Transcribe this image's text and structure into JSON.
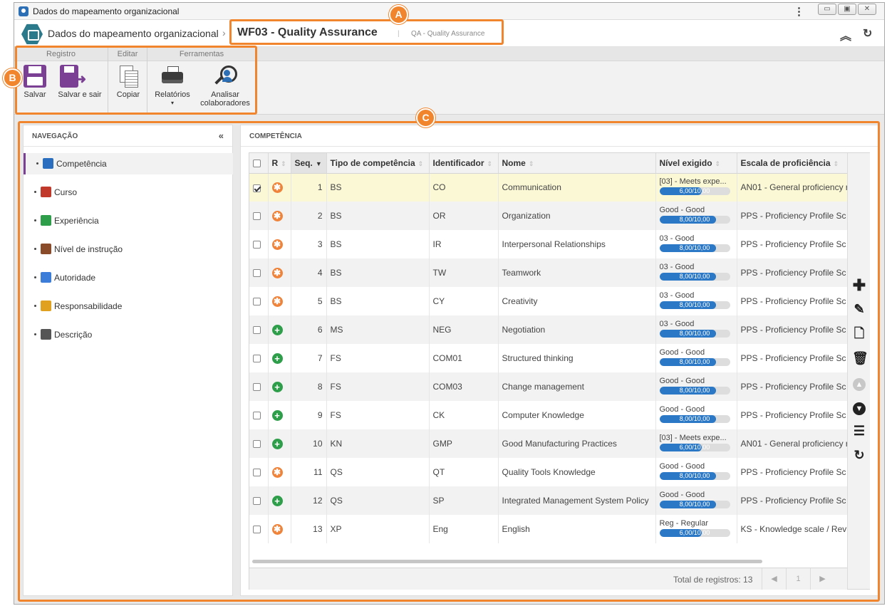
{
  "window": {
    "title": "Dados do mapeamento organizacional"
  },
  "header": {
    "breadcrumb": "Dados do mapeamento organizacional",
    "separator": "›",
    "doc_title": "WF03 - Quality Assurance",
    "pipe": "|",
    "subtitle": "QA - Quality Assurance"
  },
  "toolbar": {
    "groups": [
      "Registro",
      "Editar",
      "Ferramentas"
    ],
    "save": "Salvar",
    "save_exit": "Salvar e sair",
    "copy": "Copiar",
    "reports": "Relatórios",
    "reports_caret": "▾",
    "analyze_line1": "Analisar",
    "analyze_line2": "colaboradores"
  },
  "nav": {
    "title": "NAVEGAÇÃO",
    "items": [
      {
        "label": "Competência",
        "icon": "puzzle-icon",
        "color": "#2a6fbf"
      },
      {
        "label": "Curso",
        "icon": "course-icon",
        "color": "#c0392b"
      },
      {
        "label": "Experiência",
        "icon": "history-icon",
        "color": "#2e9e4b"
      },
      {
        "label": "Nível de instrução",
        "icon": "diploma-icon",
        "color": "#8a4b2a"
      },
      {
        "label": "Autoridade",
        "icon": "authority-icon",
        "color": "#3b7dd8"
      },
      {
        "label": "Responsabilidade",
        "icon": "responsibility-icon",
        "color": "#e0a020"
      },
      {
        "label": "Descrição",
        "icon": "description-icon",
        "color": "#555555"
      }
    ]
  },
  "main": {
    "title": "COMPETÊNCIA",
    "columns": [
      "R",
      "Seq.",
      "Tipo de competência",
      "Identificador",
      "Nome",
      "Nível exigido",
      "Escala de proficiência"
    ],
    "rows": [
      {
        "checked": true,
        "r": "req",
        "seq": "1",
        "type": "BS",
        "id": "CO",
        "name": "Communication",
        "level": "[03] - Meets expe...",
        "score": "6,00/10,00",
        "pct": 0.6,
        "scale": "AN01 - General proficiency r"
      },
      {
        "checked": false,
        "r": "req",
        "seq": "2",
        "type": "BS",
        "id": "OR",
        "name": "Organization",
        "level": "Good - Good",
        "score": "8,00/10,00",
        "pct": 0.8,
        "scale": "PPS - Proficiency Profile Sc"
      },
      {
        "checked": false,
        "r": "req",
        "seq": "3",
        "type": "BS",
        "id": "IR",
        "name": "Interpersonal Relationships",
        "level": "03 - Good",
        "score": "8,00/10,00",
        "pct": 0.8,
        "scale": "PPS - Proficiency Profile Sc"
      },
      {
        "checked": false,
        "r": "req",
        "seq": "4",
        "type": "BS",
        "id": "TW",
        "name": "Teamwork",
        "level": "03 - Good",
        "score": "8,00/10,00",
        "pct": 0.8,
        "scale": "PPS - Proficiency Profile Sc"
      },
      {
        "checked": false,
        "r": "req",
        "seq": "5",
        "type": "BS",
        "id": "CY",
        "name": "Creativity",
        "level": "03 - Good",
        "score": "8,00/10,00",
        "pct": 0.8,
        "scale": "PPS - Proficiency Profile Sc"
      },
      {
        "checked": false,
        "r": "opt",
        "seq": "6",
        "type": "MS",
        "id": "NEG",
        "name": "Negotiation",
        "level": "03 - Good",
        "score": "8,00/10,00",
        "pct": 0.8,
        "scale": "PPS - Proficiency Profile Sc"
      },
      {
        "checked": false,
        "r": "opt",
        "seq": "7",
        "type": "FS",
        "id": "COM01",
        "name": "Structured thinking",
        "level": "Good - Good",
        "score": "8,00/10,00",
        "pct": 0.8,
        "scale": "PPS - Proficiency Profile Sc"
      },
      {
        "checked": false,
        "r": "opt",
        "seq": "8",
        "type": "FS",
        "id": "COM03",
        "name": "Change management",
        "level": "Good - Good",
        "score": "8,00/10,00",
        "pct": 0.8,
        "scale": "PPS - Proficiency Profile Sc"
      },
      {
        "checked": false,
        "r": "opt",
        "seq": "9",
        "type": "FS",
        "id": "CK",
        "name": "Computer Knowledge",
        "level": "Good - Good",
        "score": "8,00/10,00",
        "pct": 0.8,
        "scale": "PPS - Proficiency Profile Sc"
      },
      {
        "checked": false,
        "r": "opt",
        "seq": "10",
        "type": "KN",
        "id": "GMP",
        "name": "Good Manufacturing Practices",
        "level": "[03] - Meets expe...",
        "score": "6,00/10,00",
        "pct": 0.6,
        "scale": "AN01 - General proficiency r"
      },
      {
        "checked": false,
        "r": "req",
        "seq": "11",
        "type": "QS",
        "id": "QT",
        "name": "Quality Tools Knowledge",
        "level": "Good - Good",
        "score": "8,00/10,00",
        "pct": 0.8,
        "scale": "PPS - Proficiency Profile Sc"
      },
      {
        "checked": false,
        "r": "opt",
        "seq": "12",
        "type": "QS",
        "id": "SP",
        "name": "Integrated Management System Policy",
        "level": "Good - Good",
        "score": "8,00/10,00",
        "pct": 0.8,
        "scale": "PPS - Proficiency Profile Sc"
      },
      {
        "checked": false,
        "r": "req",
        "seq": "13",
        "type": "XP",
        "id": "Eng",
        "name": "English",
        "level": "Reg - Regular",
        "score": "6,00/10,00",
        "pct": 0.6,
        "scale": "KS - Knowledge scale / Rev"
      }
    ],
    "total_label": "Total de registros: 13",
    "page": "1",
    "prev": "◀",
    "next": "▶"
  },
  "callouts": [
    "A",
    "B",
    "C"
  ],
  "colors": {
    "accent": "#7b3f93",
    "callout": "#f0852d",
    "progress": "#2a78c6"
  }
}
